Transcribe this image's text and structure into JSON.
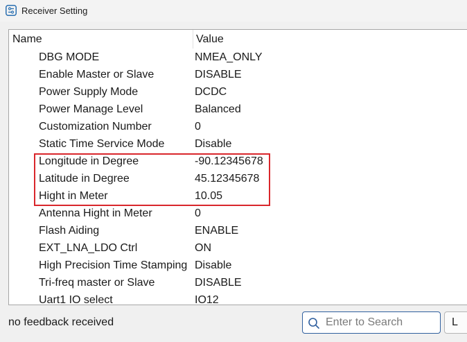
{
  "window": {
    "title": "Receiver Setting",
    "icon": "settings-sliders-icon"
  },
  "table": {
    "columns": {
      "name": "Name",
      "value": "Value"
    },
    "rows": [
      {
        "name": "DBG MODE",
        "value": "NMEA_ONLY"
      },
      {
        "name": "Enable Master or Slave",
        "value": "DISABLE"
      },
      {
        "name": "Power Supply Mode",
        "value": "DCDC"
      },
      {
        "name": "Power Manage Level",
        "value": "Balanced"
      },
      {
        "name": "Customization Number",
        "value": "0"
      },
      {
        "name": "Static Time Service Mode",
        "value": "Disable"
      },
      {
        "name": "Longitude in Degree",
        "value": "-90.12345678"
      },
      {
        "name": "Latitude in Degree",
        "value": "45.12345678"
      },
      {
        "name": "Hight in Meter",
        "value": "10.05"
      },
      {
        "name": "Antenna Hight in Meter",
        "value": "0"
      },
      {
        "name": "Flash Aiding",
        "value": "ENABLE"
      },
      {
        "name": "EXT_LNA_LDO Ctrl",
        "value": "ON"
      },
      {
        "name": "High Precision Time Stamping",
        "value": "Disable"
      },
      {
        "name": "Tri-freq master or Slave",
        "value": "DISABLE"
      },
      {
        "name": "Uart1 IO select",
        "value": "IO12"
      }
    ],
    "highlight_color": "#d9262b"
  },
  "status": {
    "text": "no feedback received"
  },
  "search": {
    "placeholder": "Enter to Search",
    "value": "",
    "icon": "search-icon"
  },
  "side_button": {
    "label": "L"
  }
}
